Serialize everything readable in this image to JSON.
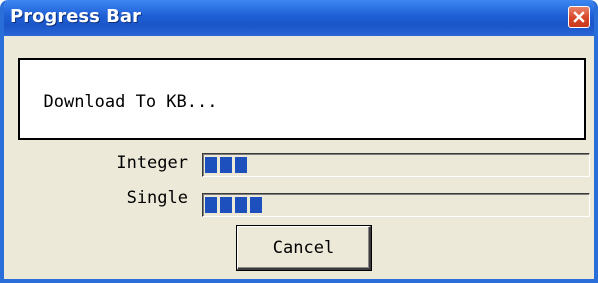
{
  "window": {
    "title": "Progress Bar",
    "close_icon": "close-icon",
    "colors": {
      "titlebar": "#1f5fd6",
      "body": "#ece9d8",
      "close": "#d8472a"
    }
  },
  "message": {
    "text": "Download To KB..."
  },
  "progress": [
    {
      "label": "Integer",
      "fraction": 0.11,
      "blocks": 3
    },
    {
      "label": "Single",
      "fraction": 0.15,
      "blocks": 4
    }
  ],
  "bar_color": "#1d4fbd",
  "buttons": {
    "cancel_label": "Cancel"
  }
}
